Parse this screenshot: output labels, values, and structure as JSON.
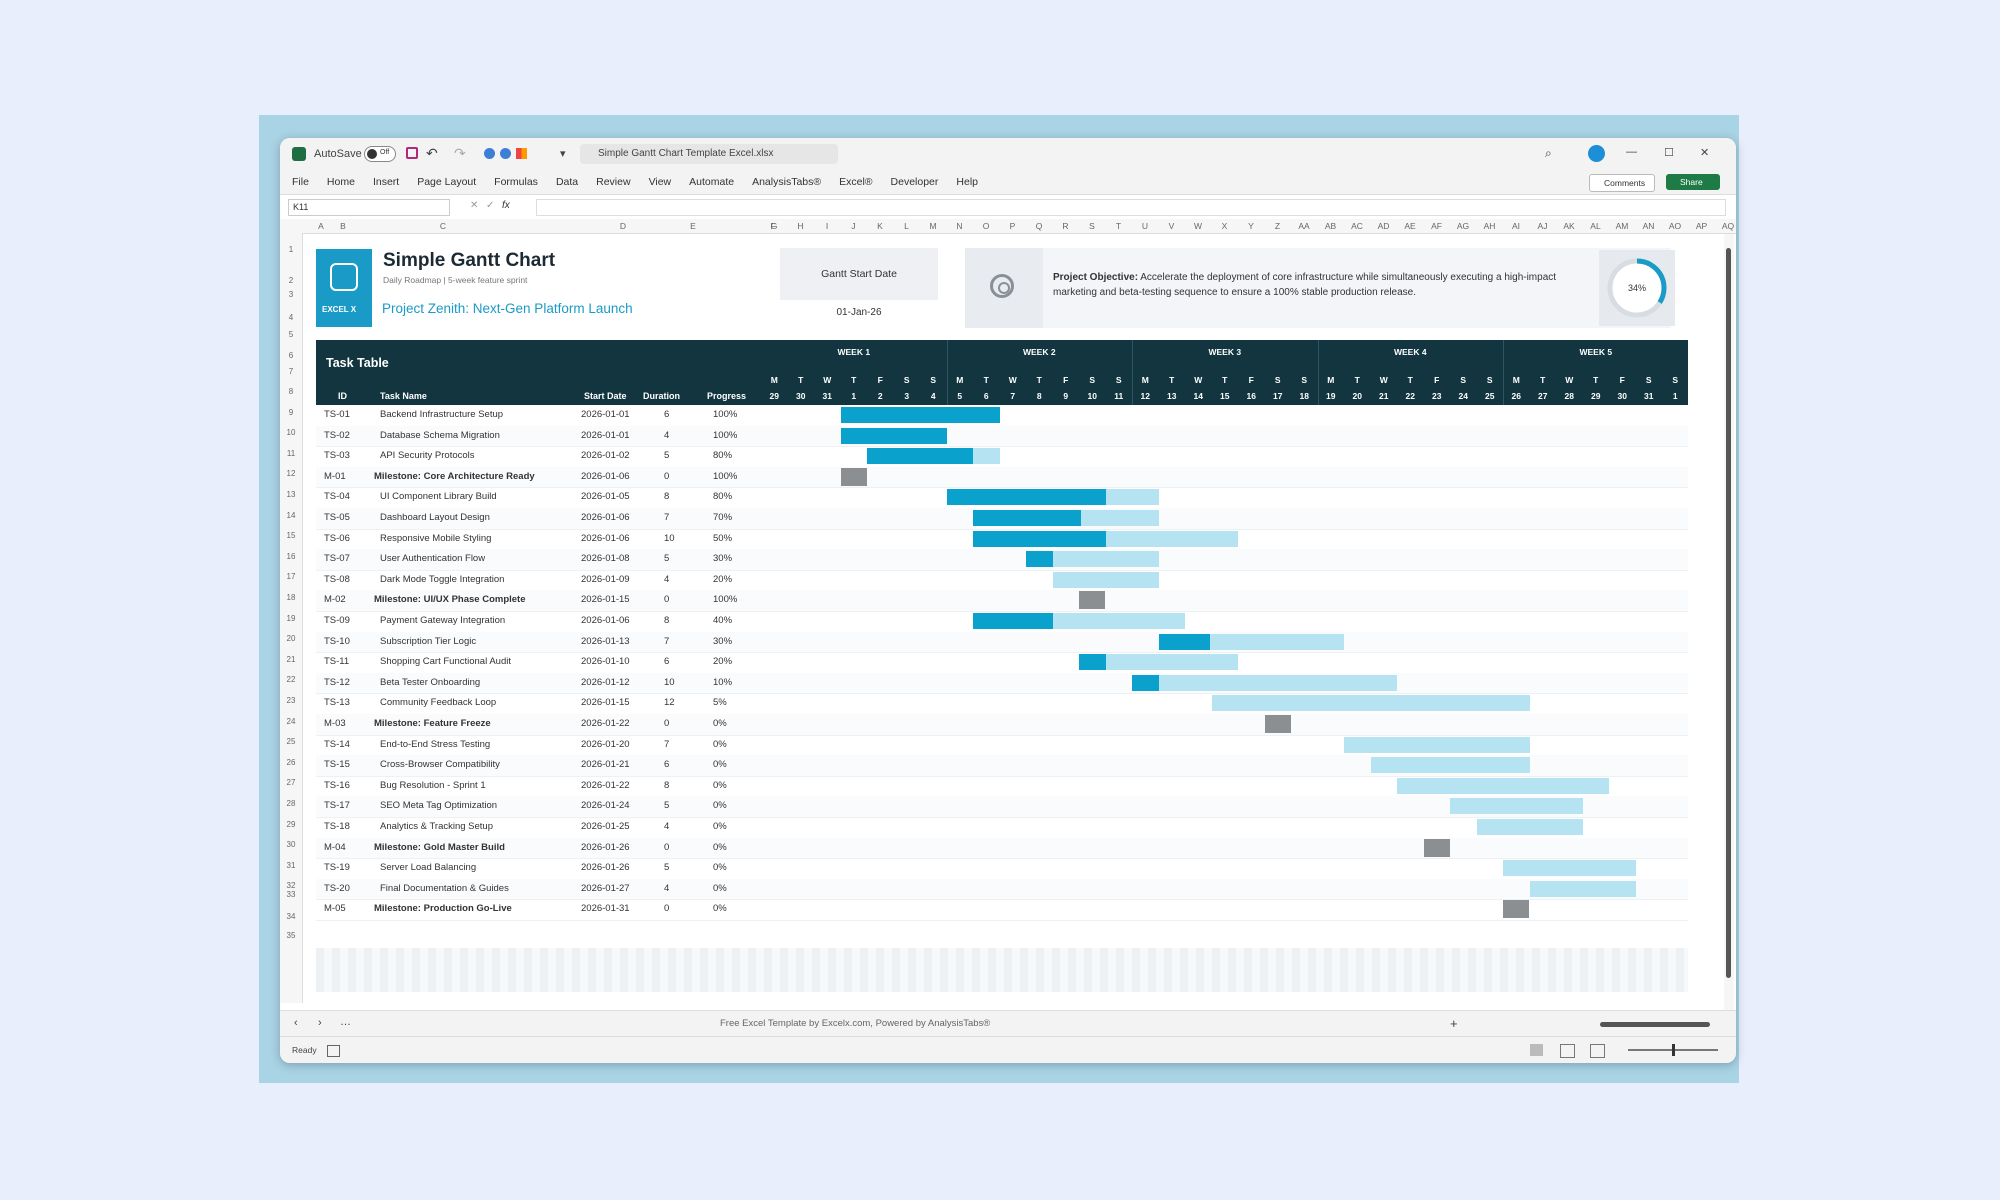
{
  "window": {
    "autosave_label": "AutoSave",
    "autosave_state": "Off",
    "filename": "Simple Gantt Chart Template Excel.xlsx",
    "controls": [
      "—",
      "☐",
      "✕"
    ]
  },
  "menu": {
    "items": [
      "File",
      "Home",
      "Insert",
      "Page Layout",
      "Formulas",
      "Data",
      "Review",
      "View",
      "Automate",
      "AnalysisTabs®",
      "Excel®",
      "Developer",
      "Help"
    ],
    "comments_label": "Comments",
    "share_label": "Share"
  },
  "formula_bar": {
    "name_box": "K11",
    "fx": "fx",
    "value": ""
  },
  "columns": [
    "A",
    "B",
    "C",
    "D",
    "E",
    "F",
    "G",
    "H",
    "I",
    "J",
    "K",
    "L",
    "M",
    "N",
    "O",
    "P",
    "Q",
    "R",
    "S",
    "T",
    "U",
    "V",
    "W",
    "X",
    "Y",
    "Z",
    "AA",
    "AB",
    "AC",
    "AD",
    "AE",
    "AF",
    "AG",
    "AH",
    "AI",
    "AJ",
    "AK",
    "AL",
    "AM",
    "AN",
    "AO",
    "AP",
    "AQ"
  ],
  "header": {
    "logo_text": "EXCEL X",
    "title": "Simple Gantt Chart",
    "subtitle": "Daily Roadmap | 5-week feature sprint",
    "project_name": "Project Zenith: Next-Gen Platform Launch",
    "start_label": "Gantt Start Date",
    "start_value": "01-Jan-26",
    "objective_label": "Project Objective:",
    "objective_text": "Accelerate the deployment of core infrastructure while simultaneously executing a high-impact marketing and beta-testing sequence to ensure a 100% stable production release.",
    "progress_percent": 34,
    "progress_label": "34%"
  },
  "table": {
    "title": "Task Table",
    "col_id": "ID",
    "col_name": "Task Name",
    "col_start": "Start Date",
    "col_duration": "Duration",
    "col_progress": "Progress",
    "weeks": [
      "WEEK 1",
      "WEEK 2",
      "WEEK 3",
      "WEEK 4",
      "WEEK 5"
    ],
    "day_letters": [
      "M",
      "T",
      "W",
      "T",
      "F",
      "S",
      "S",
      "M",
      "T",
      "W",
      "T",
      "F",
      "S",
      "S",
      "M",
      "T",
      "W",
      "T",
      "F",
      "S",
      "S",
      "M",
      "T",
      "W",
      "T",
      "F",
      "S",
      "S",
      "M",
      "T",
      "W",
      "T",
      "F",
      "S",
      "S"
    ],
    "day_numbers": [
      "29",
      "30",
      "31",
      "1",
      "2",
      "3",
      "4",
      "5",
      "6",
      "7",
      "8",
      "9",
      "10",
      "11",
      "12",
      "13",
      "14",
      "15",
      "16",
      "17",
      "18",
      "19",
      "20",
      "21",
      "22",
      "23",
      "24",
      "25",
      "26",
      "27",
      "28",
      "29",
      "30",
      "31",
      "1"
    ]
  },
  "tasks": [
    {
      "id": "TS-01",
      "name": "Backend Infrastructure Setup",
      "start": "2026-01-01",
      "duration": "6",
      "progress": "100%",
      "pct": 1.0,
      "milestone": false,
      "s": 3,
      "d": 6
    },
    {
      "id": "TS-02",
      "name": "Database Schema Migration",
      "start": "2026-01-01",
      "duration": "4",
      "progress": "100%",
      "pct": 1.0,
      "milestone": false,
      "s": 3,
      "d": 4
    },
    {
      "id": "TS-03",
      "name": "API Security Protocols",
      "start": "2026-01-02",
      "duration": "5",
      "progress": "80%",
      "pct": 0.8,
      "milestone": false,
      "s": 4,
      "d": 5
    },
    {
      "id": "M-01",
      "name": "Milestone: Core Architecture Ready",
      "start": "2026-01-06",
      "duration": "0",
      "progress": "100%",
      "pct": 1.0,
      "milestone": true,
      "s": 3,
      "d": 0
    },
    {
      "id": "TS-04",
      "name": "UI Component Library Build",
      "start": "2026-01-05",
      "duration": "8",
      "progress": "80%",
      "pct": 0.75,
      "milestone": false,
      "s": 7,
      "d": 8
    },
    {
      "id": "TS-05",
      "name": "Dashboard Layout Design",
      "start": "2026-01-06",
      "duration": "7",
      "progress": "70%",
      "pct": 0.58,
      "milestone": false,
      "s": 8,
      "d": 7
    },
    {
      "id": "TS-06",
      "name": "Responsive Mobile Styling",
      "start": "2026-01-06",
      "duration": "10",
      "progress": "50%",
      "pct": 0.5,
      "milestone": false,
      "s": 8,
      "d": 10
    },
    {
      "id": "TS-07",
      "name": "User Authentication Flow",
      "start": "2026-01-08",
      "duration": "5",
      "progress": "30%",
      "pct": 0.2,
      "milestone": false,
      "s": 10,
      "d": 5
    },
    {
      "id": "TS-08",
      "name": "Dark Mode Toggle Integration",
      "start": "2026-01-09",
      "duration": "4",
      "progress": "20%",
      "pct": 0.0,
      "milestone": false,
      "s": 11,
      "d": 4
    },
    {
      "id": "M-02",
      "name": "Milestone: UI/UX Phase Complete",
      "start": "2026-01-15",
      "duration": "0",
      "progress": "100%",
      "pct": 1.0,
      "milestone": true,
      "s": 12,
      "d": 0
    },
    {
      "id": "TS-09",
      "name": "Payment Gateway Integration",
      "start": "2026-01-06",
      "duration": "8",
      "progress": "40%",
      "pct": 0.375,
      "milestone": false,
      "s": 8,
      "d": 8
    },
    {
      "id": "TS-10",
      "name": "Subscription Tier Logic",
      "start": "2026-01-13",
      "duration": "7",
      "progress": "30%",
      "pct": 0.28,
      "milestone": false,
      "s": 15,
      "d": 7
    },
    {
      "id": "TS-11",
      "name": "Shopping Cart Functional Audit",
      "start": "2026-01-10",
      "duration": "6",
      "progress": "20%",
      "pct": 0.17,
      "milestone": false,
      "s": 12,
      "d": 6
    },
    {
      "id": "TS-12",
      "name": "Beta Tester Onboarding",
      "start": "2026-01-12",
      "duration": "10",
      "progress": "10%",
      "pct": 0.1,
      "milestone": false,
      "s": 14,
      "d": 10
    },
    {
      "id": "TS-13",
      "name": "Community Feedback Loop",
      "start": "2026-01-15",
      "duration": "12",
      "progress": "5%",
      "pct": 0.0,
      "milestone": false,
      "s": 17,
      "d": 12
    },
    {
      "id": "M-03",
      "name": "Milestone: Feature Freeze",
      "start": "2026-01-22",
      "duration": "0",
      "progress": "0%",
      "pct": 0.0,
      "milestone": true,
      "s": 19,
      "d": 0
    },
    {
      "id": "TS-14",
      "name": "End-to-End Stress Testing",
      "start": "2026-01-20",
      "duration": "7",
      "progress": "0%",
      "pct": 0.0,
      "milestone": false,
      "s": 22,
      "d": 7
    },
    {
      "id": "TS-15",
      "name": "Cross-Browser Compatibility",
      "start": "2026-01-21",
      "duration": "6",
      "progress": "0%",
      "pct": 0.0,
      "milestone": false,
      "s": 23,
      "d": 6
    },
    {
      "id": "TS-16",
      "name": "Bug Resolution - Sprint 1",
      "start": "2026-01-22",
      "duration": "8",
      "progress": "0%",
      "pct": 0.0,
      "milestone": false,
      "s": 24,
      "d": 8
    },
    {
      "id": "TS-17",
      "name": "SEO Meta Tag Optimization",
      "start": "2026-01-24",
      "duration": "5",
      "progress": "0%",
      "pct": 0.0,
      "milestone": false,
      "s": 26,
      "d": 5
    },
    {
      "id": "TS-18",
      "name": "Analytics & Tracking Setup",
      "start": "2026-01-25",
      "duration": "4",
      "progress": "0%",
      "pct": 0.0,
      "milestone": false,
      "s": 27,
      "d": 4
    },
    {
      "id": "M-04",
      "name": "Milestone: Gold Master Build",
      "start": "2026-01-26",
      "duration": "0",
      "progress": "0%",
      "pct": 0.0,
      "milestone": true,
      "s": 25,
      "d": 0
    },
    {
      "id": "TS-19",
      "name": "Server Load Balancing",
      "start": "2026-01-26",
      "duration": "5",
      "progress": "0%",
      "pct": 0.0,
      "milestone": false,
      "s": 28,
      "d": 5
    },
    {
      "id": "TS-20",
      "name": "Final Documentation & Guides",
      "start": "2026-01-27",
      "duration": "4",
      "progress": "0%",
      "pct": 0.0,
      "milestone": false,
      "s": 29,
      "d": 4
    },
    {
      "id": "M-05",
      "name": "Milestone: Production Go-Live",
      "start": "2026-01-31",
      "duration": "0",
      "progress": "0%",
      "pct": 0.0,
      "milestone": true,
      "s": 28,
      "d": 0
    }
  ],
  "sheet_bar": {
    "caption": "Free Excel Template by Excelx.com, Powered by AnalysisTabs®",
    "add": "+"
  },
  "status": {
    "ready": "Ready"
  },
  "colors": {
    "header_dark": "#12353f",
    "bar_done": "#0aa1cc",
    "bar_remaining": "#b6e3f1",
    "milestone": "#8c8f91",
    "logo": "#1a9bc7",
    "accent": "#0e9fcb"
  }
}
